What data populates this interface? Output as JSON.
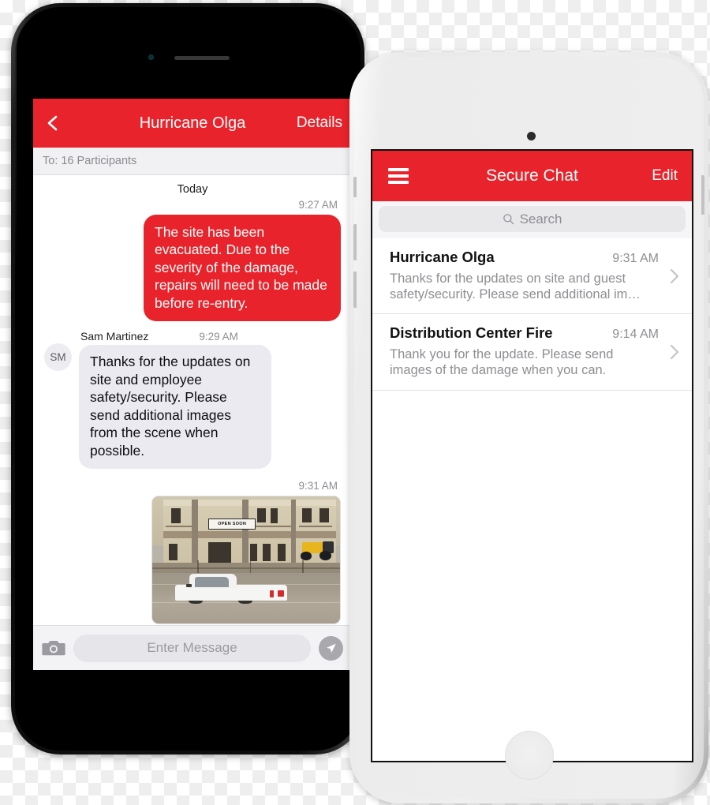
{
  "theme": {
    "red": "#e8232b",
    "bubble_in_bg": "#eceaf1",
    "text_muted": "#8e8e93"
  },
  "left_phone": {
    "device": "black-iphone",
    "chat": {
      "header": {
        "back_icon": "chevron-left-icon",
        "title": "Hurricane Olga",
        "details_label": "Details"
      },
      "participants_label": "To: 16 Participants",
      "day_divider": "Today",
      "messages": [
        {
          "direction": "outgoing",
          "time": "9:27 AM",
          "text": "The site has been evacuated. Due to the severity of the damage, repairs will need to be made before re-entry."
        },
        {
          "direction": "incoming",
          "sender": "Sam Martinez",
          "avatar_initials": "SM",
          "time": "9:29 AM",
          "text": "Thanks for the updates on site and employee safety/security. Please send additional images from the scene when possible."
        },
        {
          "direction": "outgoing",
          "type": "photo",
          "time": "9:31 AM",
          "photo_alt": "Flooded street with white pickup truck submerged in front of a damaged two-story building",
          "photo_sign_text": "OPEN SOON"
        }
      ],
      "input_bar": {
        "camera_icon": "camera-icon",
        "placeholder": "Enter Message",
        "send_icon": "send-paper-plane-icon"
      }
    }
  },
  "right_phone": {
    "device": "white-iphone",
    "list": {
      "header": {
        "menu_icon": "hamburger-menu-icon",
        "title": "Secure Chat",
        "edit_label": "Edit"
      },
      "search": {
        "icon": "search-icon",
        "placeholder": "Search"
      },
      "conversations": [
        {
          "name": "Hurricane Olga",
          "time": "9:31 AM",
          "preview": "Thanks for the updates on site and guest safety/security. Please send additional im…",
          "chevron_icon": "chevron-right-icon"
        },
        {
          "name": "Distribution Center Fire",
          "time": "9:14 AM",
          "preview": "Thank you for the update. Please send images of the damage when you can.",
          "chevron_icon": "chevron-right-icon"
        }
      ]
    }
  }
}
